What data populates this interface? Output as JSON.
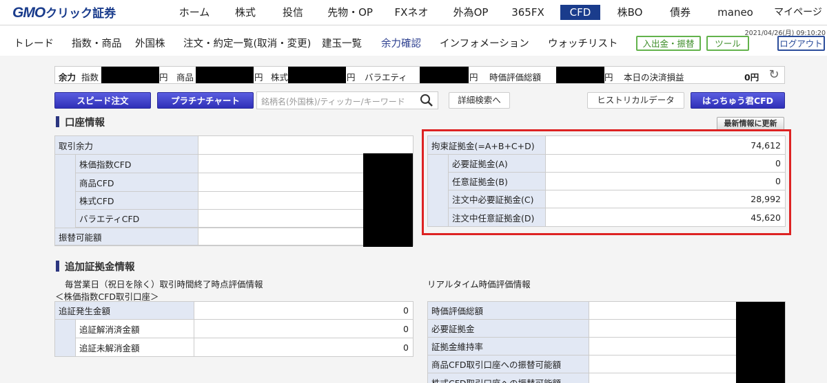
{
  "logo": {
    "gmo": "GMO",
    "rest": "クリック証券"
  },
  "topnav": {
    "items": [
      "ホーム",
      "株式",
      "投信",
      "先物・OP",
      "FXネオ",
      "外為OP",
      "365FX",
      "CFD",
      "株BO",
      "債券",
      "maneo",
      "マイページ"
    ],
    "active": "CFD"
  },
  "subnav": {
    "items": [
      "トレード",
      "指数・商品",
      "外国株",
      "注文・約定一覧(取消・変更)",
      "建玉一覧",
      "余力確認",
      "インフォメーション",
      "ウォッチリスト"
    ],
    "active": "余力確認",
    "deposit_button": "入出金・振替",
    "tool_button": "ツール",
    "logout_button": "ログアウト",
    "datetime": "2021/04/26(月) 09:10:20"
  },
  "summary_bar": {
    "yoryoku_label": "余力",
    "index_label": "指数",
    "commodity_label": "商品",
    "stock_label": "株式",
    "variety_label": "バラエティ",
    "yen": "円",
    "valuation_label": "時価評価総額",
    "settlement_label": "本日の決済損益",
    "settlement_value": "0円"
  },
  "toolbar": {
    "speed_order": "スピード注文",
    "platinum_chart": "プラチナチャート",
    "search_placeholder": "銘柄名(外国株)/ティッカー/キーワード",
    "detail_search": "詳細検索へ",
    "historical": "ヒストリカルデータ",
    "hacchu": "はっちゅう君CFD"
  },
  "account_info": {
    "title": "口座情報",
    "latest_button": "最新情報に更新",
    "left_rows": [
      {
        "label": "取引余力"
      },
      {
        "label": "株価指数CFD"
      },
      {
        "label": "商品CFD"
      },
      {
        "label": "株式CFD"
      },
      {
        "label": "バラエティCFD"
      },
      {
        "label": "振替可能額"
      }
    ],
    "right_rows": [
      {
        "label": "拘束証拠金(=A+B+C+D)",
        "value": "74,612"
      },
      {
        "label": "必要証拠金(A)",
        "value": "0"
      },
      {
        "label": "任意証拠金(B)",
        "value": "0"
      },
      {
        "label": "注文中必要証拠金(C)",
        "value": "28,992"
      },
      {
        "label": "注文中任意証拠金(D)",
        "value": "45,620"
      }
    ]
  },
  "margin_call": {
    "title": "追加証拠金情報",
    "daily_caption": "毎営業日（祝日を除く）取引時間終了時点評価情報",
    "account_caption": "＜株価指数CFD取引口座＞",
    "realtime_caption": "リアルタイム時価評価情報",
    "left_rows": [
      {
        "label": "追証発生金額",
        "value": "0"
      },
      {
        "label": "追証解消済金額",
        "value": "0"
      },
      {
        "label": "追証未解消金額",
        "value": "0"
      }
    ],
    "right_rows": [
      {
        "label": "時価評価総額"
      },
      {
        "label": "必要証拠金"
      },
      {
        "label": "証拠金維持率"
      },
      {
        "label": "商品CFD取引口座への振替可能額"
      },
      {
        "label": "株式CFD取引口座への振替可能額"
      }
    ]
  },
  "colors": {
    "brand": "#1a3c8c",
    "highlight_frame": "#dd2222",
    "label_bg": "#e2e8f4",
    "button_blue": "#3a3cc8"
  }
}
